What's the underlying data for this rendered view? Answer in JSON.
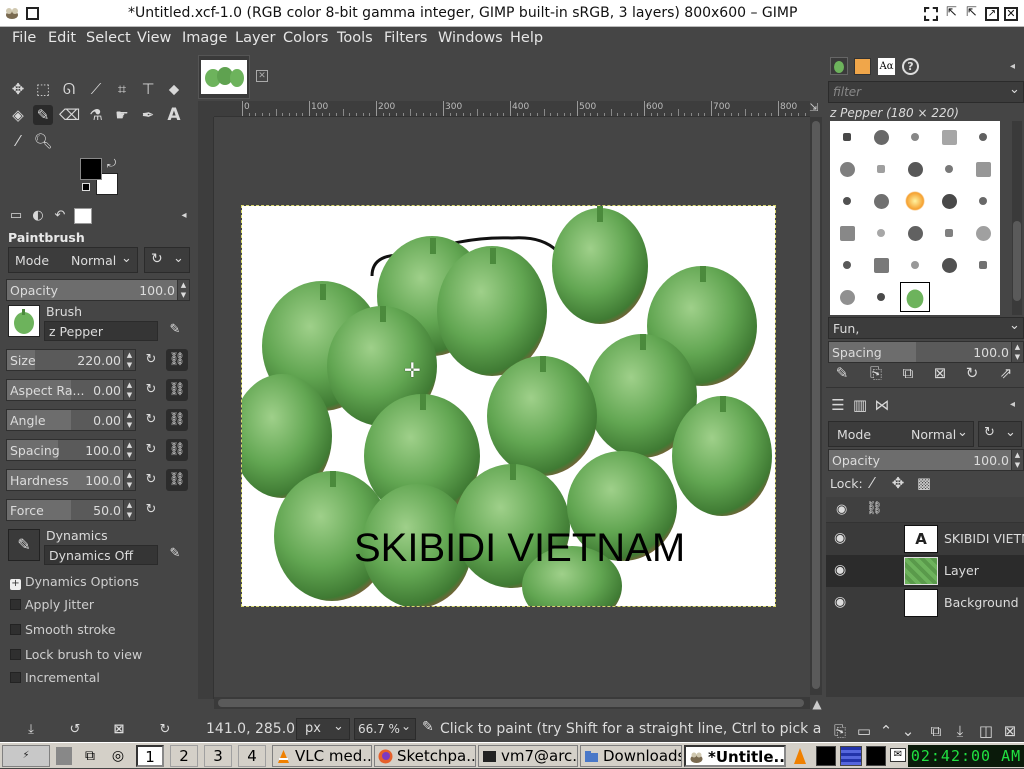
{
  "title": "*Untitled.xcf-1.0 (RGB color 8-bit gamma integer, GIMP built-in sRGB, 3 layers) 800x600 – GIMP",
  "menu": [
    "File",
    "Edit",
    "Select",
    "View",
    "Image",
    "Layer",
    "Colors",
    "Tools",
    "Filters",
    "Windows",
    "Help"
  ],
  "tool_options": {
    "tool_name": "Paintbrush",
    "mode_label": "Mode",
    "mode_value": "Normal",
    "opacity_label": "Opacity",
    "opacity_value": "100.0",
    "opacity_fraction": 1.0,
    "brush_label": "Brush",
    "brush_value": "z Pepper",
    "size_label": "Size",
    "size_value": "220.00",
    "size_fraction": 0.22,
    "aspect_label": "Aspect Ra...",
    "aspect_value": "0.00",
    "aspect_fraction": 0.5,
    "angle_label": "Angle",
    "angle_value": "0.00",
    "angle_fraction": 0.5,
    "spacing_label": "Spacing",
    "spacing_value": "100.0",
    "spacing_fraction": 0.4,
    "hardness_label": "Hardness",
    "hardness_value": "100.0",
    "hardness_fraction": 1.0,
    "force_label": "Force",
    "force_value": "50.0",
    "force_fraction": 0.5,
    "dynamics_label": "Dynamics",
    "dynamics_value": "Dynamics Off",
    "dynamics_options": "Dynamics Options",
    "checkboxes": [
      "Apply Jitter",
      "Smooth stroke",
      "Lock brush to view",
      "Incremental"
    ]
  },
  "ruler_ticks": [
    "0",
    "100",
    "200",
    "300",
    "400",
    "500",
    "600",
    "700",
    "800"
  ],
  "canvas_text": "SKIBIDI VIETNAM",
  "brushes": {
    "filter_placeholder": "filter",
    "selected_brush": "z Pepper (180 × 220)",
    "tag": "Fun,",
    "spacing_label": "Spacing",
    "spacing_value": "100.0"
  },
  "layers": {
    "mode_label": "Mode",
    "mode_value": "Normal",
    "opacity_label": "Opacity",
    "opacity_value": "100.0",
    "lock_label": "Lock:",
    "items": [
      {
        "name": "SKIBIDI VIETNA"
      },
      {
        "name": "Layer"
      },
      {
        "name": "Background"
      }
    ]
  },
  "status": {
    "coords": "141.0, 285.0",
    "unit": "px",
    "zoom": "66.7 %",
    "message": "Click to paint (try Shift for a straight line, Ctrl to pick a col..."
  },
  "taskbar": {
    "workspaces": [
      "1",
      "2",
      "3",
      "4"
    ],
    "tasks": [
      "VLC med...",
      "Sketchpa...",
      "vm7@arc...",
      "Downloads",
      "*Untitle..."
    ],
    "clock": "02:42:00 AM"
  },
  "colors": {
    "fg": "#000000",
    "bg": "#ffffff",
    "accent": "#6db35c"
  }
}
